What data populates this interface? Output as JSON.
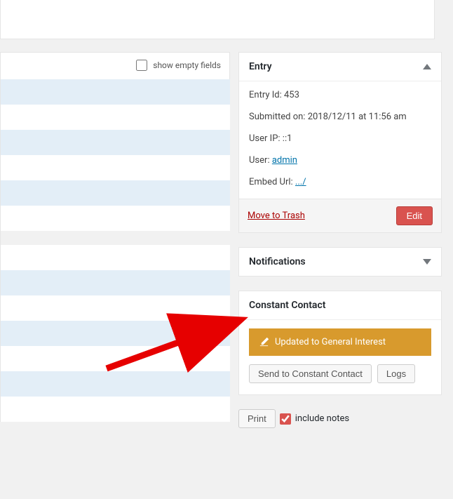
{
  "toolbar": {
    "show_empty_label": "show empty fields"
  },
  "entry_box": {
    "title": "Entry",
    "id_label": "Entry Id:",
    "id_value": "453",
    "submitted_label": "Submitted on:",
    "submitted_value": "2018/12/11 at 11:56 am",
    "userip_label": "User IP:",
    "userip_value": "::1",
    "user_label": "User:",
    "user_value": "admin",
    "embed_label": "Embed Url:",
    "embed_value": ".../",
    "trash": "Move to Trash",
    "edit": "Edit"
  },
  "notifications": {
    "title": "Notifications"
  },
  "constant_contact": {
    "title": "Constant Contact",
    "status": "Updated to General Interest",
    "send_btn": "Send to Constant Contact",
    "logs_btn": "Logs"
  },
  "print": {
    "btn": "Print",
    "include_notes": "include notes"
  },
  "colors": {
    "accent_gold": "#d89a2d",
    "link_blue": "#0073aa",
    "danger_red": "#d9534f"
  }
}
